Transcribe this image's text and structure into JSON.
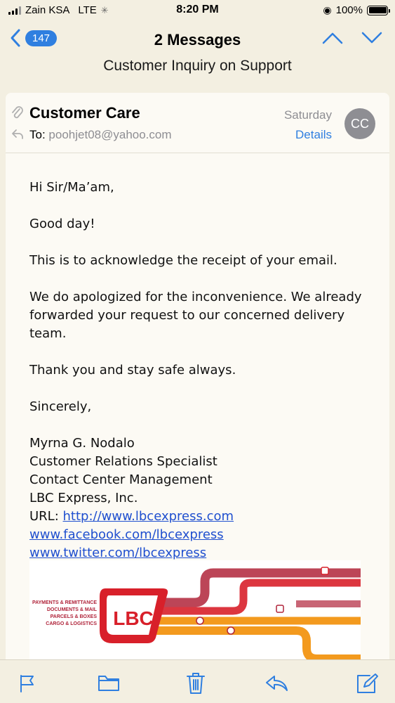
{
  "status_bar": {
    "carrier": "Zain KSA",
    "network": "LTE",
    "time": "8:20 PM",
    "battery": "100%",
    "battery_level": 1.0
  },
  "nav": {
    "back_count": "147",
    "title": "2 Messages",
    "subtitle": "Customer Inquiry on Support"
  },
  "email": {
    "sender": "Customer Care",
    "to_label": "To:",
    "to_address": "poohjet08@yahoo.com",
    "date": "Saturday",
    "details_label": "Details",
    "avatar_initials": "CC",
    "greeting": "Hi Sir/Ma’am,",
    "p1": "Good day!",
    "p2": "This is to acknowledge the receipt of your email.",
    "p3": "We do apologized for the inconvenience. We already forwarded your request to our concerned delivery team.",
    "p4": "Thank you and stay safe always.",
    "closing": "Sincerely,",
    "signature": {
      "name": "Myrna G. Nodalo",
      "role": "Customer Relations Specialist",
      "dept": "Contact Center Management",
      "company": "LBC Express, Inc.",
      "url_label": "URL: ",
      "url": "http://www.lbcexpress.com",
      "facebook": "www.facebook.com/lbcexpress",
      "twitter": "www.twitter.com/lbcexpress"
    },
    "banner": {
      "logo_text": "LBC",
      "services": [
        "PAYMENTS & REMITTANCE",
        "DOCUMENTS & MAIL",
        "PARCELS & BOXES",
        "CARGO & LOGISTICS"
      ]
    }
  },
  "colors": {
    "accent": "#2f7fe0",
    "lbc_red": "#d8202a",
    "lbc_orange": "#f39a1e",
    "lbc_maroon": "#b0243a"
  },
  "toolbar": {
    "icons": [
      "flag-icon",
      "folder-icon",
      "trash-icon",
      "reply-icon",
      "compose-icon"
    ]
  }
}
